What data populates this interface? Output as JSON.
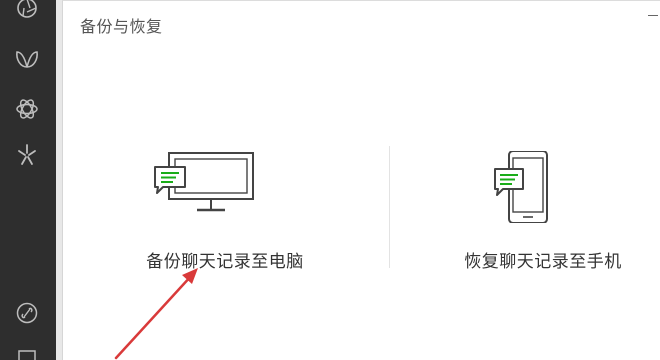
{
  "dialog": {
    "title": "备份与恢复"
  },
  "options": [
    {
      "label": "备份聊天记录至电脑",
      "icon": "monitor-chat-icon"
    },
    {
      "label": "恢复聊天记录至手机",
      "icon": "phone-chat-icon"
    }
  ],
  "sidebar": {
    "icons": [
      "moments-icon",
      "channels-icon",
      "mini-program-icon",
      "discover-icon",
      "link-icon",
      "more-icon"
    ]
  },
  "colors": {
    "accent_green": "#1aad19",
    "sidebar_bg": "#2e2e2e",
    "annotation_arrow": "#d93a3a"
  }
}
